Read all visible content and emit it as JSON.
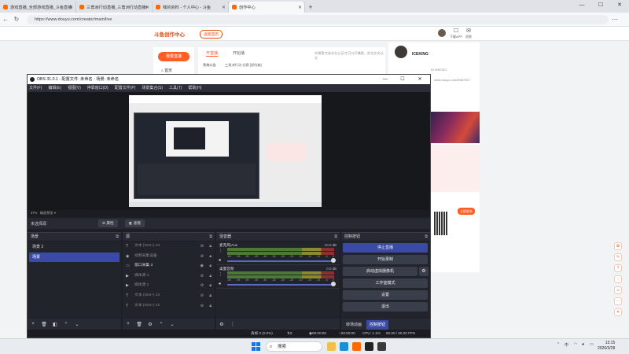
{
  "browser": {
    "tabs": [
      {
        "title": "游戏直播_全部游戏直播_斗鱼直播",
        "active": false
      },
      {
        "title": "三角洲行动直播_三角洲行动直播t",
        "active": false
      },
      {
        "title": "我的资料 - 个人中心 - 斗鱼",
        "active": false
      },
      {
        "title": "创作中心",
        "active": true
      }
    ],
    "url": "https://www.douyu.com/creator/main/live"
  },
  "site": {
    "logo": "斗鱼创作中心",
    "logo_sub": "返回首页",
    "header_icons": [
      {
        "icon": "bell-icon",
        "label": "下载APP"
      },
      {
        "icon": "message-icon",
        "label": "消息"
      }
    ],
    "live_button": "我要直播",
    "home_item": "首页",
    "center_tabs": [
      "开直播",
      "开始播"
    ],
    "notice": "你需要完成实名认证才可以开播哦，前往实名认证",
    "bulletin_label": "系统公告",
    "bulletin_text": "三角洲行动-比赛 [保险箱]",
    "user_name": "ICEKING",
    "user_stat": "ID 5967507",
    "user_url": "www.douyu.com/5967507",
    "promo_button": "立即报名"
  },
  "obs": {
    "title": "OBS 31.0.1 - 配置文件: 未命名 - 场景: 未命名",
    "menu": [
      "文件(F)",
      "编辑(E)",
      "视图(V)",
      "停靠窗口(D)",
      "配置文件(P)",
      "场景集合(S)",
      "工具(T)",
      "帮助(H)"
    ],
    "zoom": "37%",
    "zoom_label": "缩放预览",
    "no_source": "未选择源",
    "props_btn": "属性",
    "filter_btn": "滤镜",
    "scenes_title": "场景",
    "scenes": [
      {
        "name": "场景 2",
        "selected": false
      },
      {
        "name": "场景",
        "selected": true
      }
    ],
    "sources_title": "源",
    "sources": [
      {
        "name": "文本 (GDI+) 24",
        "icon": "T",
        "visible": false
      },
      {
        "name": "视频采集设备",
        "icon": "📷",
        "visible": false
      },
      {
        "name": "窗口采集 3",
        "icon": "▭",
        "visible": true
      },
      {
        "name": "媒体源 3",
        "icon": "▶",
        "visible": false
      },
      {
        "name": "媒体源 2",
        "icon": "▶",
        "visible": false
      },
      {
        "name": "文本 (GDI+) 23",
        "icon": "T",
        "visible": false
      },
      {
        "name": "文本 (GDI+) 22",
        "icon": "T",
        "visible": false
      }
    ],
    "mixer_title": "混音器",
    "mixer": [
      {
        "name": "麦克风/Aux",
        "db": "-10.0 dB"
      },
      {
        "name": "桌面音频",
        "db": "0.0 dB"
      }
    ],
    "meter_ticks": [
      "-60",
      "-55",
      "-50",
      "-45",
      "-40",
      "-35",
      "-30",
      "-25",
      "-20",
      "-15",
      "-10",
      "-5",
      "0"
    ],
    "controls_title": "控制按钮",
    "controls": [
      "停止直播",
      "开始录制",
      "启动虚拟摄像机",
      "工作室模式",
      "设置",
      "退出"
    ],
    "bottom_tabs": [
      "转场动画",
      "控制按钮"
    ],
    "status": {
      "dropped": "丢帧 0 (0.0%)",
      "kbps": "0 kbps",
      "live_time": "00:00:00",
      "rec_time": "00:00:00",
      "cpu": "CPU: 1.1%",
      "fps": "60.00 / 60.00 FPS"
    }
  },
  "taskbar": {
    "search": "搜索",
    "time": "13:15",
    "date": "2026/3/28",
    "ime": "中"
  }
}
